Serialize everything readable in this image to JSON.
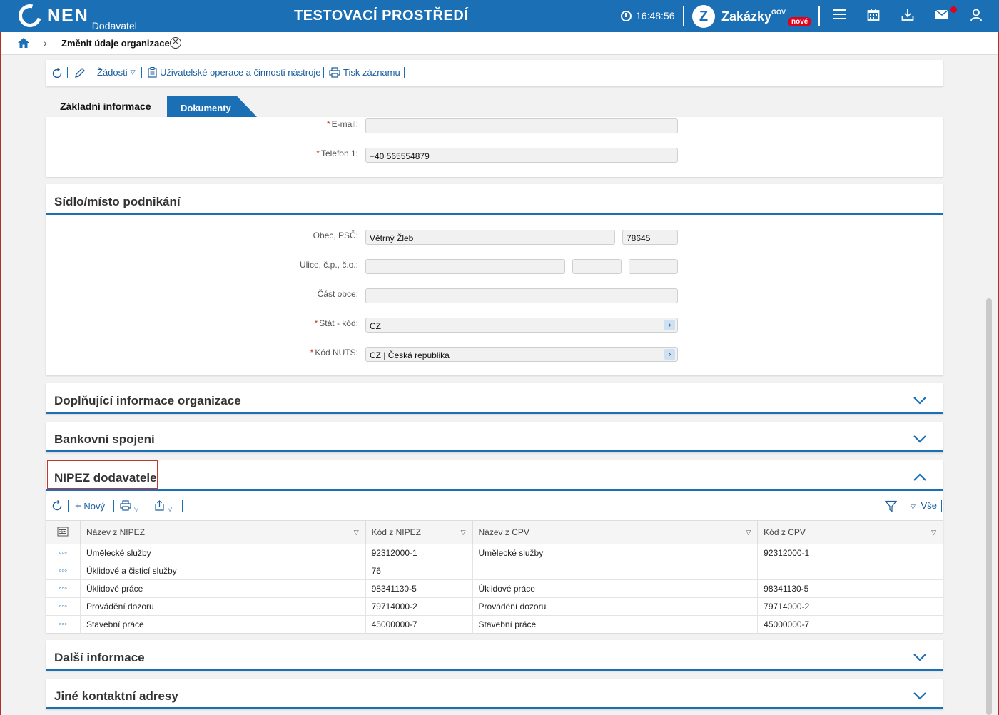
{
  "header": {
    "logo_text": "NEN",
    "logo_sub": "Dodavatel",
    "env_title": "TESTOVACÍ PROSTŘEDÍ",
    "time": "16:48:56",
    "zakazky_label": "Zakázky",
    "zakazky_gov": "GOV",
    "zakazky_badge": "nové",
    "icons": [
      "menu-icon",
      "calendar-icon",
      "download-icon",
      "mail-icon",
      "user-icon"
    ]
  },
  "breadcrumb": {
    "title": "Změnit údaje organizace"
  },
  "toolbar": {
    "zadosti": "Žádosti",
    "operace": "Uživatelské operace a činnosti nástroje",
    "tisk": "Tisk záznamu"
  },
  "tabs": {
    "basic": "Základní informace",
    "docs": "Dokumenty"
  },
  "contact": {
    "email_label": "E-mail:",
    "email_value": "",
    "phone_label": "Telefon 1:",
    "phone_value": "+40 565554879"
  },
  "sidlo": {
    "title": "Sídlo/místo podnikání",
    "obec_label": "Obec, PSČ:",
    "obec_value": "Větrný Žleb",
    "psc_value": "78645",
    "ulice_label": "Ulice, č.p., č.o.:",
    "ulice_value": "",
    "cp_value": "",
    "co_value": "",
    "cast_label": "Část obce:",
    "cast_value": "",
    "stat_label": "Stát - kód:",
    "stat_value": "CZ",
    "nuts_label": "Kód NUTS:",
    "nuts_value": "CZ | Česká republika"
  },
  "sections": {
    "doplnujici": "Doplňující informace organizace",
    "bankovni": "Bankovní spojení",
    "nipez": "NIPEZ dodavatele",
    "dalsi": "Další informace",
    "jine": "Jiné kontaktní adresy"
  },
  "nipez_grid": {
    "new_label": "Nový",
    "all_label": "Vše",
    "columns": [
      "Název z NIPEZ",
      "Kód z NIPEZ",
      "Název z CPV",
      "Kód z CPV"
    ],
    "rows": [
      [
        "Umělecké služby",
        "92312000-1",
        "Umělecké služby",
        "92312000-1"
      ],
      [
        "Úklidové a čisticí služby",
        "76",
        "",
        ""
      ],
      [
        "Úklidové práce",
        "98341130-5",
        "Úklidové práce",
        "98341130-5"
      ],
      [
        "Provádění dozoru",
        "79714000-2",
        "Provádění dozoru",
        "79714000-2"
      ],
      [
        "Stavební práce",
        "45000000-7",
        "Stavební práce",
        "45000000-7"
      ]
    ]
  }
}
